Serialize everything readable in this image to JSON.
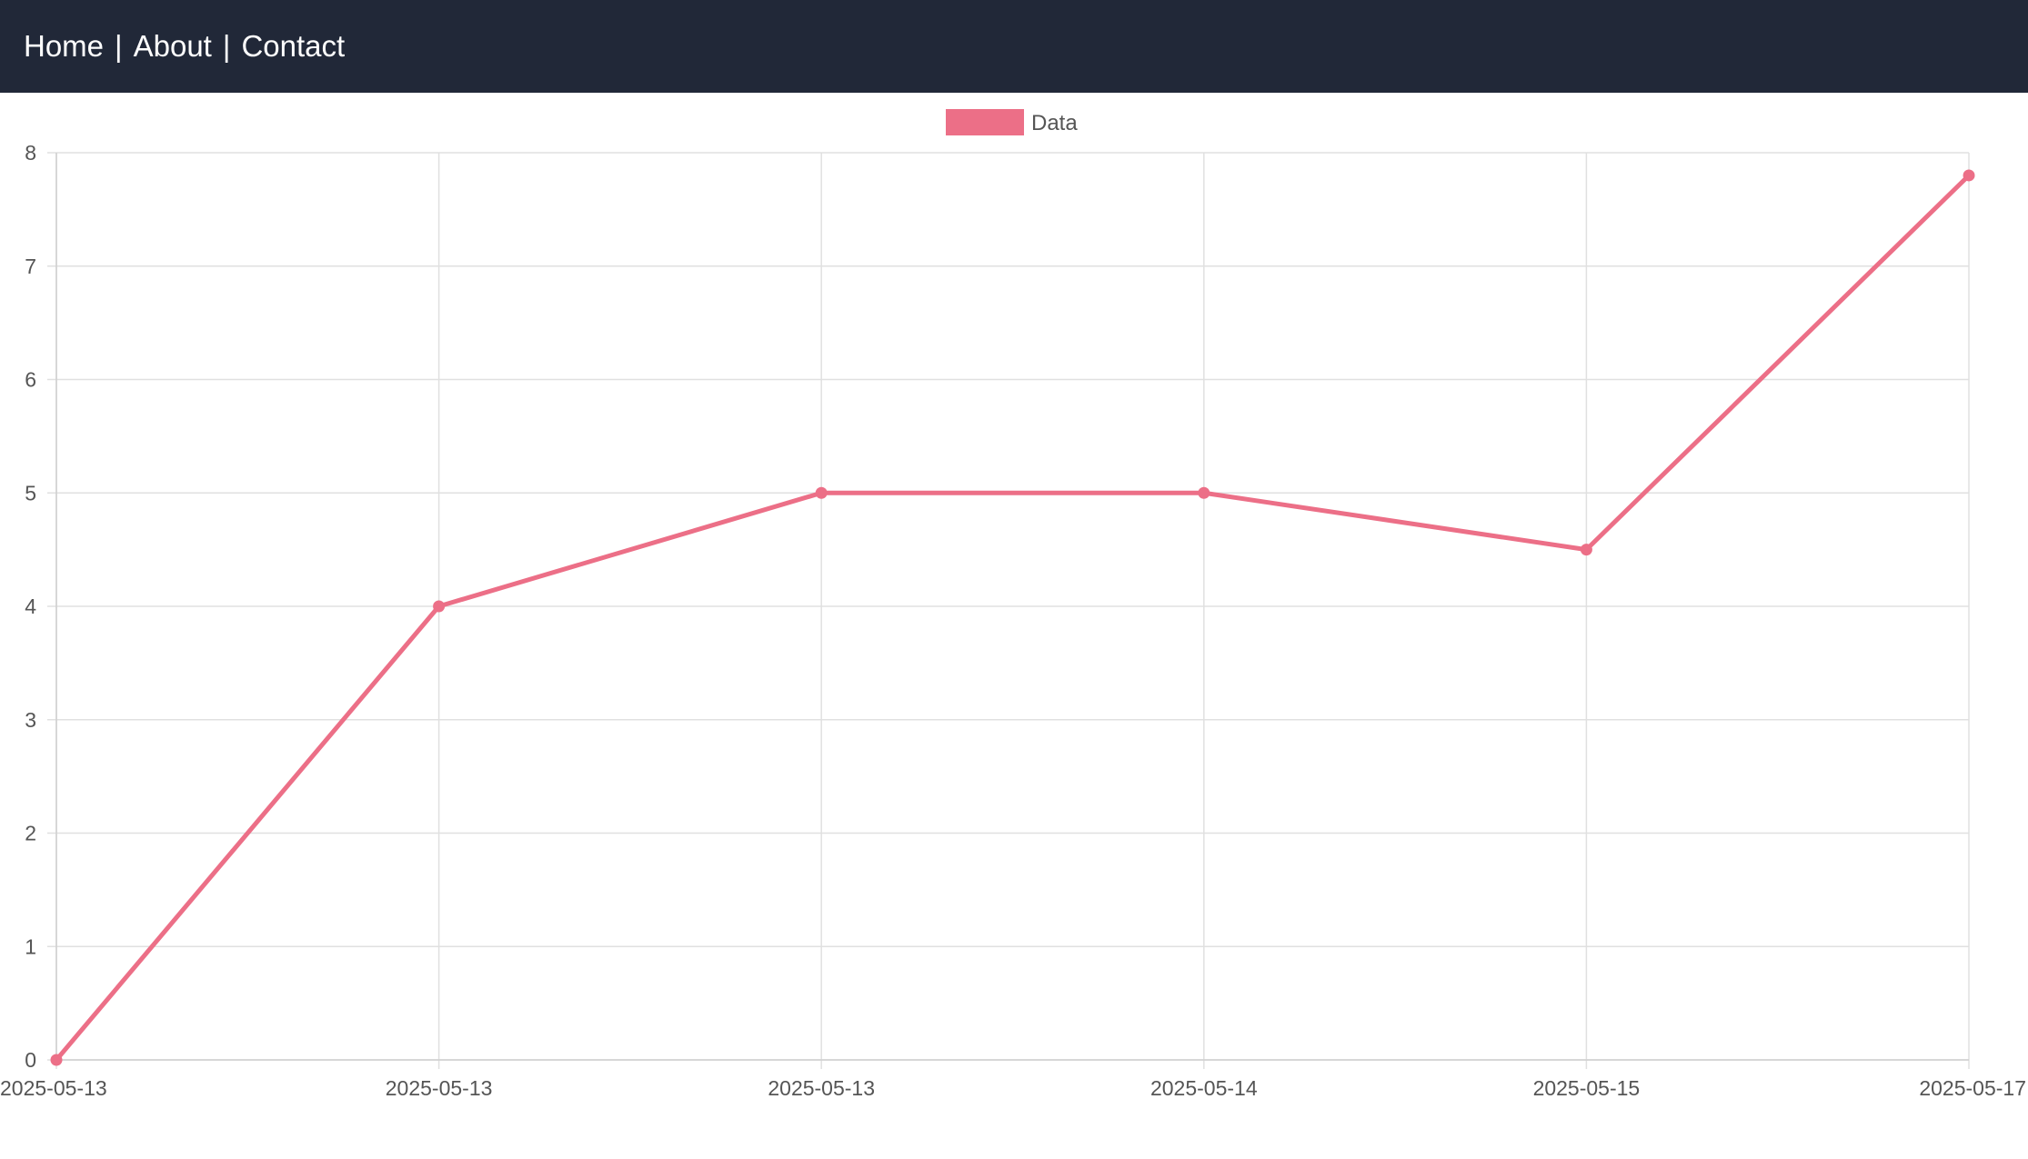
{
  "nav": {
    "items": [
      "Home",
      "About",
      "Contact"
    ],
    "separator": "|"
  },
  "colors": {
    "nav_bg": "#212838",
    "series": "#ec6f87",
    "grid": "#e0e0e0",
    "axis_text": "#555555"
  },
  "chart_data": {
    "type": "line",
    "legend_position": "top-center",
    "grid": true,
    "x": [
      "2025-05-13",
      "2025-05-13",
      "2025-05-13",
      "2025-05-14",
      "2025-05-15",
      "2025-05-17"
    ],
    "ylim": [
      0,
      8
    ],
    "yticks": [
      0,
      1,
      2,
      3,
      4,
      5,
      6,
      7,
      8
    ],
    "series": [
      {
        "name": "Data",
        "values": [
          0,
          4,
          5,
          5,
          4.5,
          7.8
        ]
      }
    ]
  }
}
